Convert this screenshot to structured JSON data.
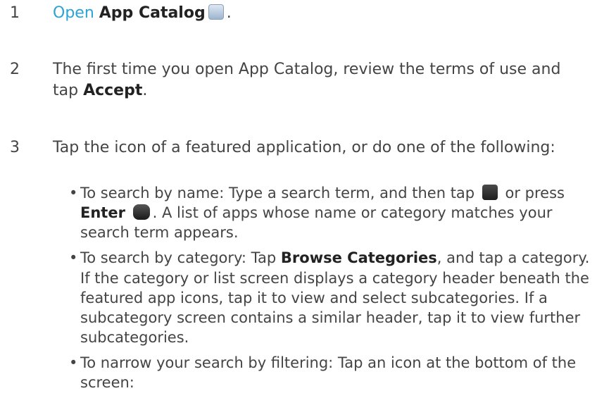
{
  "steps": [
    {
      "number": "1",
      "link_text": "Open",
      "bold_text": "App Catalog",
      "trailing": "."
    },
    {
      "number": "2",
      "text": "The first time you open App Catalog, review the terms of use and tap",
      "bold_text": "Accept",
      "trailing": "."
    },
    {
      "number": "3",
      "text": "Tap the icon of a featured application, or do one of the following:"
    }
  ],
  "bullets": [
    {
      "pre": "To search by name: Type a search term, and then tap",
      "mid": "or press",
      "bold": "Enter",
      "post": ". A list of apps whose name or category matches your search term appears."
    },
    {
      "pre": "To search by category: Tap",
      "bold": "Browse Categories",
      "post": ", and tap a category. If the category or list screen displays a category header beneath the featured app icons, tap it to view and select subcategories. If a subcategory screen contains a similar header, tap it to view further subcategories."
    },
    {
      "text": "To narrow your search by filtering: Tap an icon at the bottom of the screen:"
    }
  ],
  "colors": {
    "link": "#2aa3d6",
    "text": "#444444",
    "bold": "#222222"
  },
  "icons": [
    "app-catalog-icon",
    "search-icon",
    "enter-key-icon"
  ]
}
